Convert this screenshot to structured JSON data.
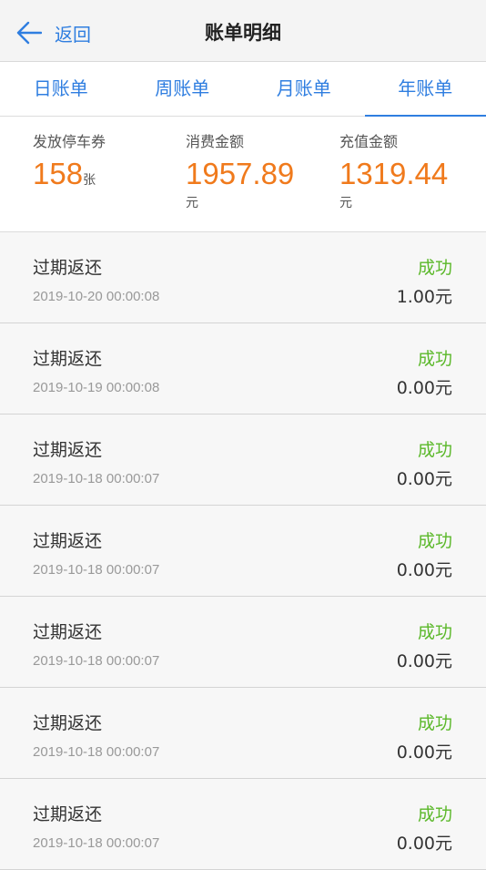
{
  "header": {
    "back_label": "返回",
    "title": "账单明细"
  },
  "tabs": [
    {
      "label": "日账单",
      "active": false
    },
    {
      "label": "周账单",
      "active": false
    },
    {
      "label": "月账单",
      "active": false
    },
    {
      "label": "年账单",
      "active": true
    }
  ],
  "summary": {
    "coupons": {
      "label": "发放停车券",
      "value": "158",
      "unit": "张"
    },
    "spend": {
      "label": "消费金额",
      "value": "1957.89",
      "unit": "元"
    },
    "recharge": {
      "label": "充值金额",
      "value": "1319.44",
      "unit": "元"
    }
  },
  "records": [
    {
      "title": "过期返还",
      "time": "2019-10-20 00:00:08",
      "status": "成功",
      "amount": "1.00元"
    },
    {
      "title": "过期返还",
      "time": "2019-10-19 00:00:08",
      "status": "成功",
      "amount": "0.00元"
    },
    {
      "title": "过期返还",
      "time": "2019-10-18 00:00:07",
      "status": "成功",
      "amount": "0.00元"
    },
    {
      "title": "过期返还",
      "time": "2019-10-18 00:00:07",
      "status": "成功",
      "amount": "0.00元"
    },
    {
      "title": "过期返还",
      "time": "2019-10-18 00:00:07",
      "status": "成功",
      "amount": "0.00元"
    },
    {
      "title": "过期返还",
      "time": "2019-10-18 00:00:07",
      "status": "成功",
      "amount": "0.00元"
    },
    {
      "title": "过期返还",
      "time": "2019-10-18 00:00:07",
      "status": "成功",
      "amount": "0.00元"
    }
  ],
  "colors": {
    "accent": "#2f7ee0",
    "amount_orange": "#f07a1c",
    "success_green": "#5bb82a"
  }
}
